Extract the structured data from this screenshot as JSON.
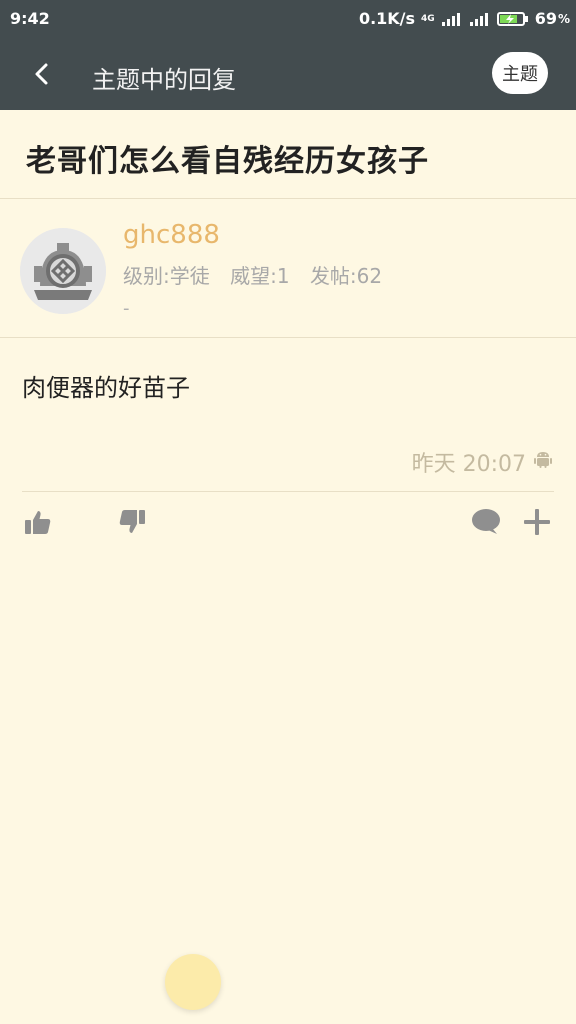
{
  "status_bar": {
    "time": "9:42",
    "net_speed": "0.1K/s",
    "network_type": "4G",
    "battery": "69",
    "battery_unit": "%"
  },
  "nav": {
    "title": "主题中的回复",
    "topic_button": "主题"
  },
  "topic": {
    "title": "老哥们怎么看自残经历女孩子"
  },
  "post": {
    "username": "ghc888",
    "level": "级别:学徒",
    "reputation": "威望:1",
    "posts": "发帖:62",
    "signature": "-",
    "content": "肉便器的好苗子",
    "time": "昨天 20:07"
  },
  "colors": {
    "topbar": "#434c4f",
    "background": "#fef8e3",
    "username": "#e8b76c",
    "fab": "#fcebaa"
  },
  "icons": {
    "back": "back-arrow-icon",
    "avatar": "diving-helmet-icon",
    "client": "android-icon",
    "like": "thumbs-up-icon",
    "dislike": "thumbs-down-icon",
    "comment": "comment-icon",
    "add": "plus-icon"
  }
}
